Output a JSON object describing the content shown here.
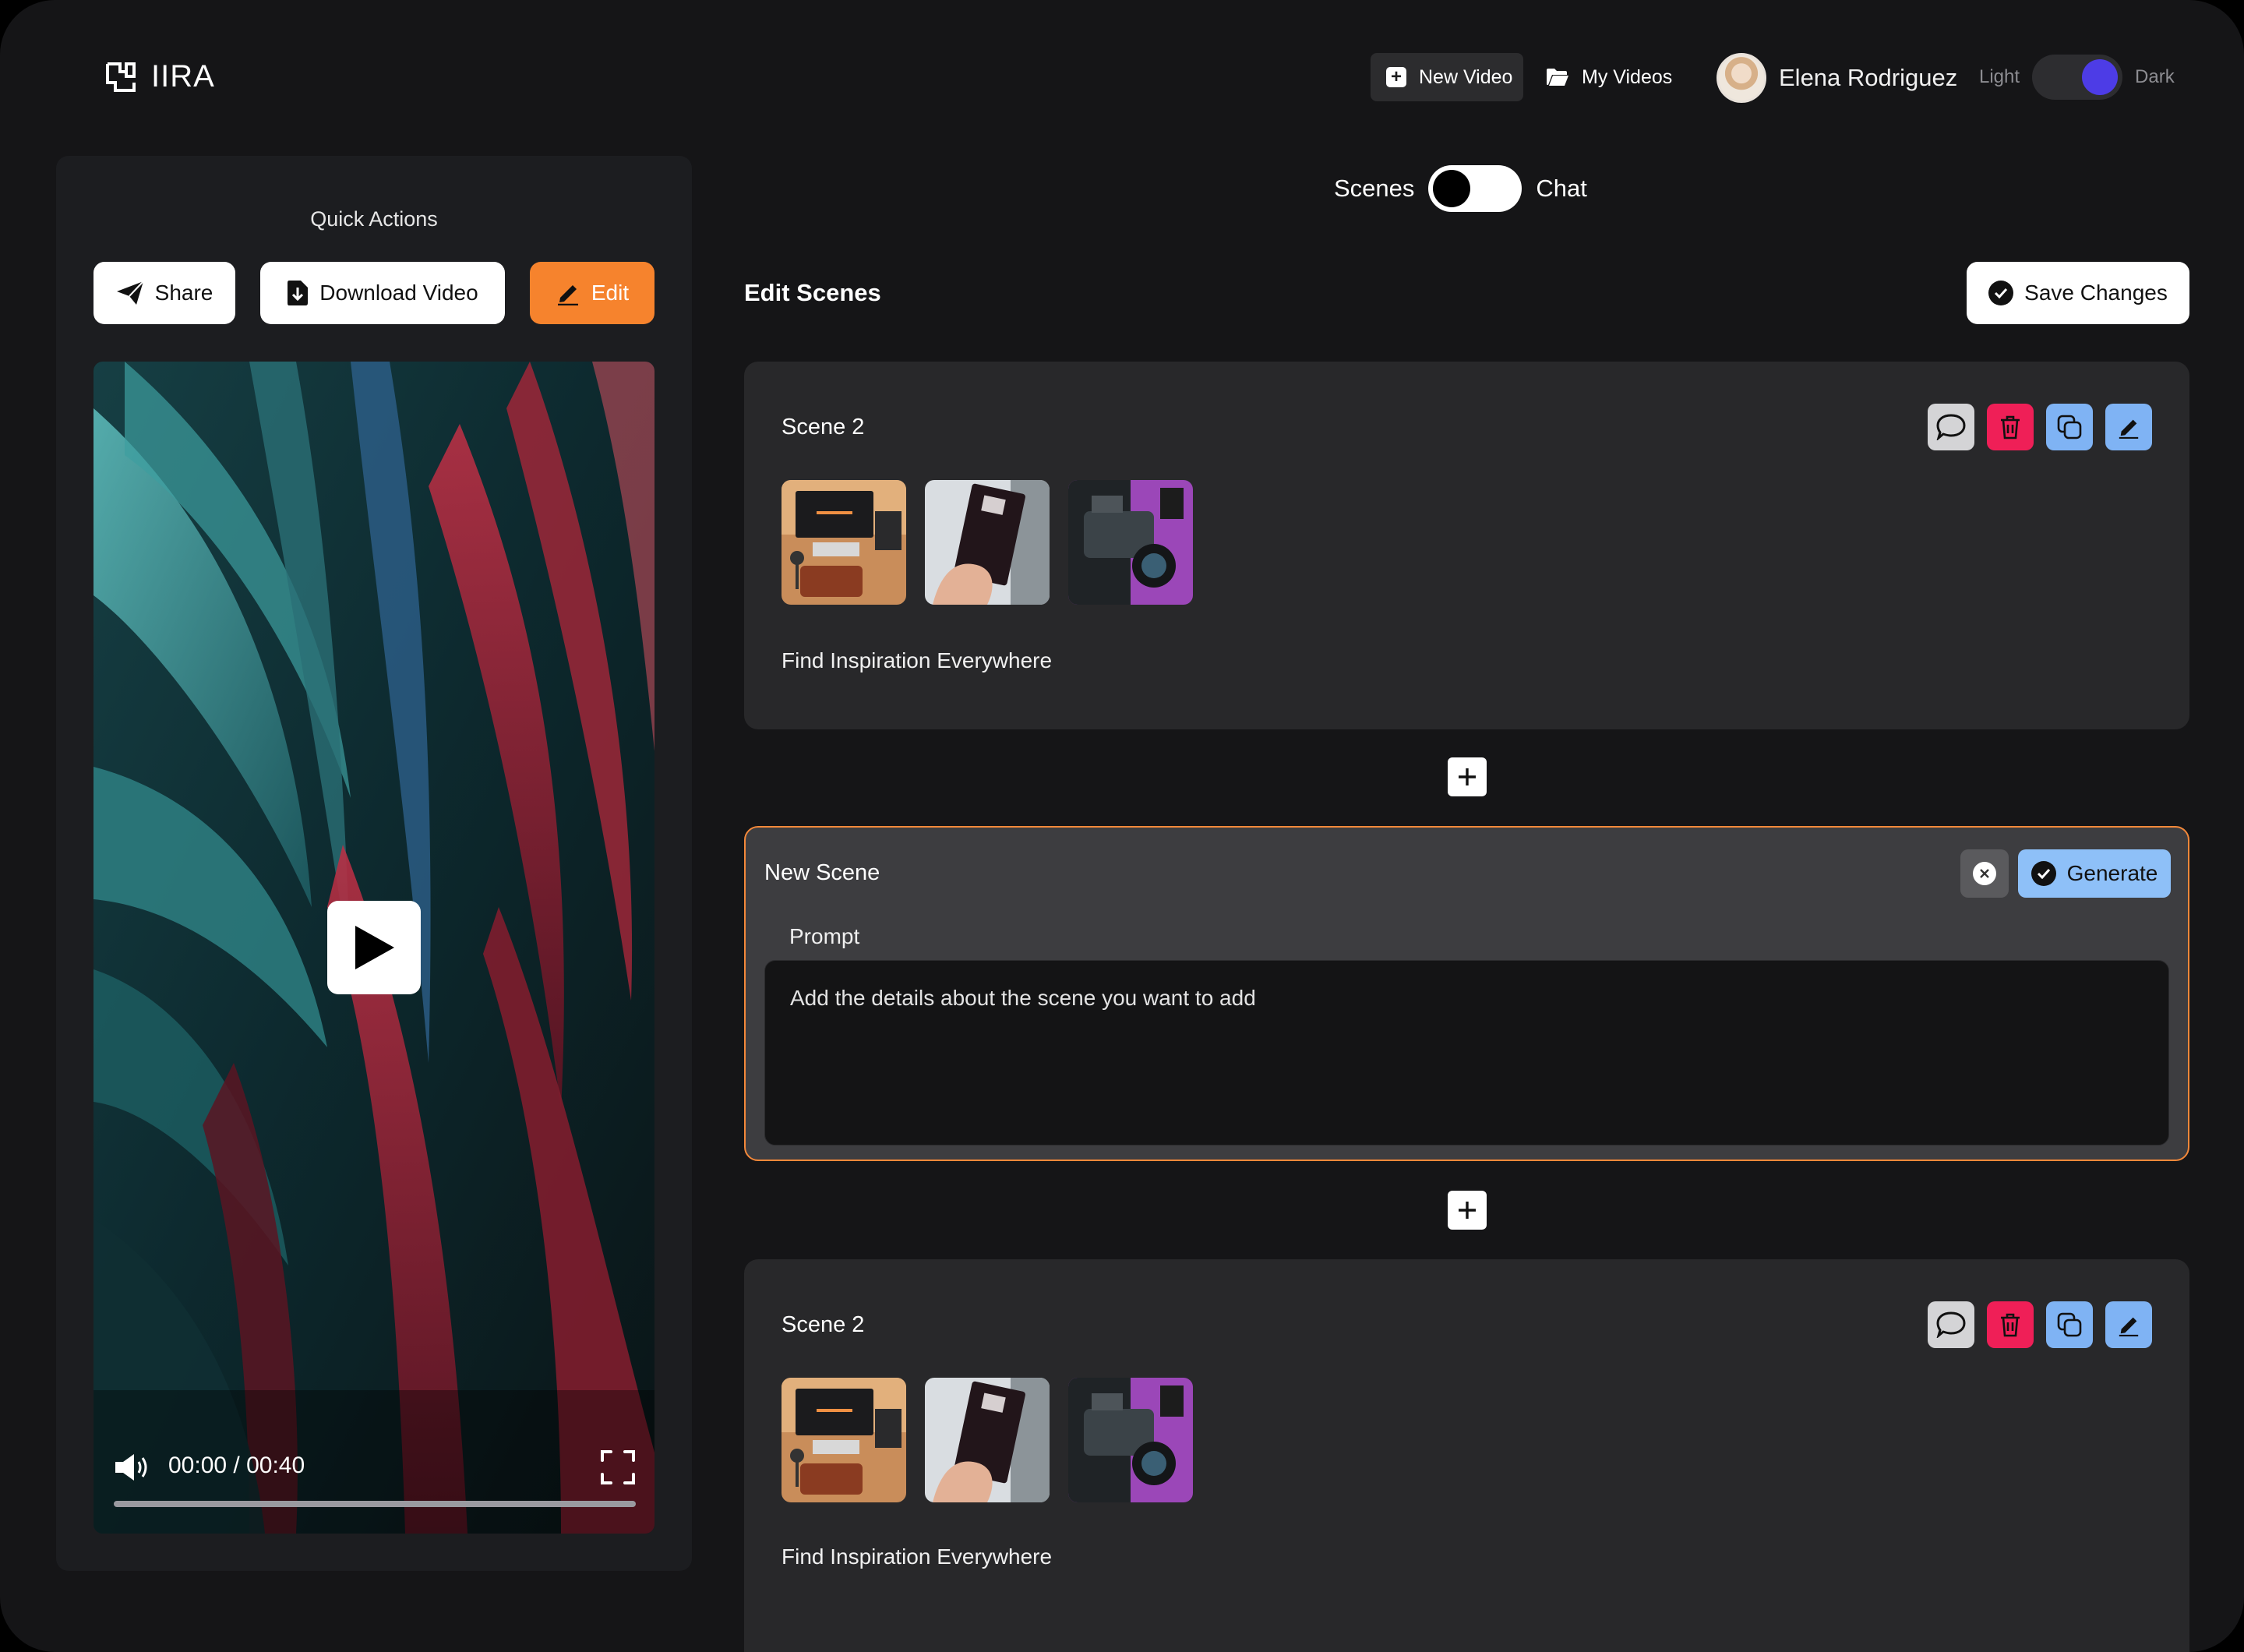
{
  "app": {
    "logo_text": "IIRA"
  },
  "header": {
    "new_video_label": "New Video",
    "my_videos_label": "My Videos",
    "user_name": "Elena Rodriguez",
    "theme": {
      "light_label": "Light",
      "dark_label": "Dark",
      "selected": "Dark"
    }
  },
  "quick_actions": {
    "title": "Quick Actions",
    "share_label": "Share",
    "download_label": "Download Video",
    "edit_label": "Edit"
  },
  "player": {
    "time": "00:00 / 00:40",
    "progress": 0
  },
  "mode_toggle": {
    "left_label": "Scenes",
    "right_label": "Chat",
    "selected": "Scenes"
  },
  "editor": {
    "title": "Edit Scenes",
    "save_label": "Save Changes",
    "scenes": [
      {
        "title": "Scene 2",
        "caption": "Find Inspiration Everywhere",
        "thumbnails": [
          "studio-desk",
          "vhs-tape-hand",
          "camera-purple"
        ]
      },
      {
        "title": "Scene 2",
        "caption": "Find Inspiration Everywhere",
        "thumbnails": [
          "studio-desk",
          "vhs-tape-hand",
          "camera-purple"
        ]
      }
    ],
    "new_scene": {
      "title": "New Scene",
      "generate_label": "Generate",
      "prompt_label": "Prompt",
      "prompt_placeholder": "Add the details about the scene you want to add",
      "prompt_value": ""
    }
  },
  "colors": {
    "background": "#151517",
    "panel": "#1c1d20",
    "card": "#28282a",
    "accent_orange": "#f6832d",
    "accent_blue": "#7fb3f4",
    "danger": "#ef1f57",
    "toggle_purple": "#4d3ce6"
  }
}
